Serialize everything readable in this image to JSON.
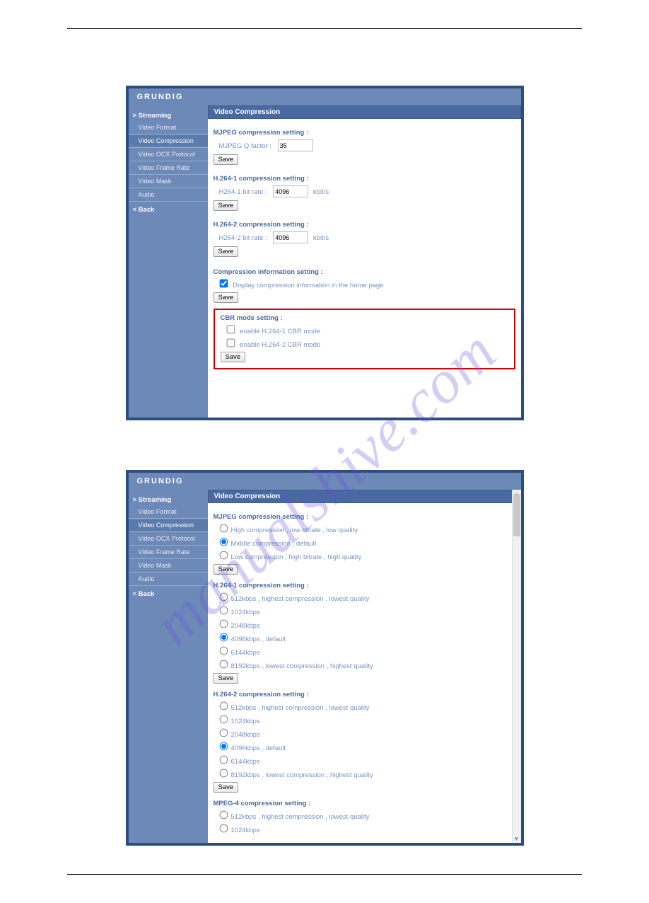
{
  "watermark": "manualshive.com",
  "brand": "GRUNDIG",
  "sidebar": {
    "title": "> Streaming",
    "items": [
      "Video Format",
      "Video Compression",
      "Video OCX Protocol",
      "Video Frame Rate",
      "Video Mask",
      "Audio"
    ],
    "back": "< Back",
    "active": "Video Compression"
  },
  "shot1": {
    "panel": "Video Compression",
    "mjpeg_head": "MJPEG compression setting :",
    "mjpeg_label": "MJPEG Q factor :",
    "mjpeg_value": "35",
    "h1_head": "H.264-1 compression setting :",
    "h1_label": "H264-1 bit rate :",
    "h1_value": "4096",
    "unit": "kbit/s",
    "h2_head": "H.264-2 compression setting :",
    "h2_label": "H264-2 bit rate :",
    "h2_value": "4096",
    "info_head": "Compression information setting :",
    "info_opt": "Display compression information in the home page",
    "cbr_head": "CBR mode setting :",
    "cbr1": "enable H.264-1 CBR mode",
    "cbr2": "enable H.264-2 CBR mode",
    "save": "Save"
  },
  "shot2": {
    "panel": "Video Compression",
    "mjpeg_head": "MJPEG compression setting :",
    "mjpeg_opts": [
      "High compression , low bitrate , low quality",
      "Middle compression , default",
      "Low compression , high bitrate , high quality"
    ],
    "mjpeg_sel": 1,
    "h1_head": "H.264-1 compression setting :",
    "bitrate_opts": [
      "512kbps , highest compression , lowest quality",
      "1024kbps",
      "2048kbps",
      "4096kbps , default",
      "6144kbps",
      "8192kbps , lowest compression , highest quality"
    ],
    "h1_sel": 3,
    "h2_head": "H.264-2 compression setting :",
    "h2_sel": 3,
    "mp4_head": "MPEG-4 compression setting :",
    "mp4_opts": [
      "512kbps , highest compression , lowest quality",
      "1024kbps"
    ],
    "save": "Save"
  }
}
